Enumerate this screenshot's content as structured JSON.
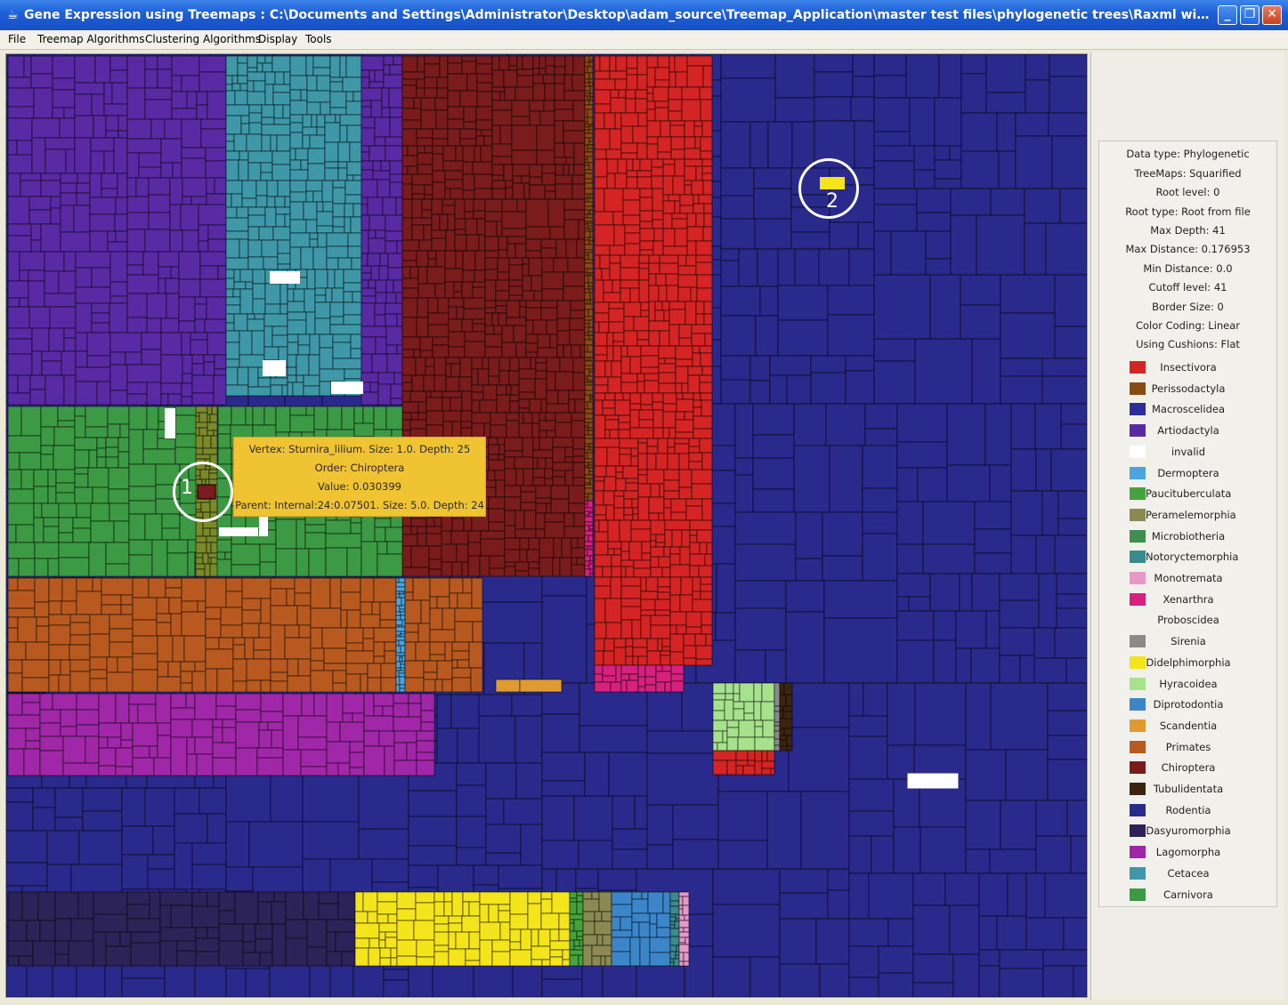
{
  "window": {
    "title": "Gene Expression using Treemaps : C:\\Documents and Settings\\Administrator\\Desktop\\adam_source\\Treemap_Application\\master test files\\phylogenetic trees\\Raxml with order file\\RAxML_re...",
    "minimize": "_",
    "maximize": "❐",
    "close": "✕"
  },
  "menu": [
    "File",
    "Treemap Algorithms",
    "Clustering Algorithms",
    "Display",
    "Tools"
  ],
  "info": [
    "Data type: Phylogenetic",
    "TreeMaps: Squarified",
    "Root level: 0",
    "Root type: Root from file",
    "Max Depth: 41",
    "Max Distance: 0.176953",
    "Min Distance: 0.0",
    "Cutoff level: 41",
    "Border Size: 0",
    "Color Coding: Linear",
    "Using Cushions: Flat"
  ],
  "legend": [
    {
      "label": "Insectivora",
      "color": "#d42424"
    },
    {
      "label": "Perissodactyla",
      "color": "#8a4b12"
    },
    {
      "label": "Macroscelidea",
      "color": "#2c2c9c"
    },
    {
      "label": "Artiodactyla",
      "color": "#5a2aa4"
    },
    {
      "label": "invalid",
      "color": "#ffffff"
    },
    {
      "label": "Dermoptera",
      "color": "#4aa4e0"
    },
    {
      "label": "Paucituberculata",
      "color": "#46a23c"
    },
    {
      "label": "Peramelemorphia",
      "color": "#8a8a52"
    },
    {
      "label": "Microbiotheria",
      "color": "#3e8e50"
    },
    {
      "label": "Notoryctemorphia",
      "color": "#3a8a8e"
    },
    {
      "label": "Monotremata",
      "color": "#e898c8"
    },
    {
      "label": "Xenarthra",
      "color": "#d8207e"
    },
    {
      "label": "Proboscidea",
      "color": "#f1f0ea"
    },
    {
      "label": "Sirenia",
      "color": "#8a8a8a"
    },
    {
      "label": "Didelphimorphia",
      "color": "#f4e41c"
    },
    {
      "label": "Hyracoidea",
      "color": "#a6e28c"
    },
    {
      "label": "Diprotodontia",
      "color": "#3a86c8"
    },
    {
      "label": "Scandentia",
      "color": "#e09a32"
    },
    {
      "label": "Primates",
      "color": "#b85a20"
    },
    {
      "label": "Chiroptera",
      "color": "#7a1c1c"
    },
    {
      "label": "Tubulidentata",
      "color": "#3c2410"
    },
    {
      "label": "Rodentia",
      "color": "#2a2a8c"
    },
    {
      "label": "Dasyuromorphia",
      "color": "#2c2458"
    },
    {
      "label": "Lagomorpha",
      "color": "#a028a8"
    },
    {
      "label": "Cetacea",
      "color": "#3e98a8"
    },
    {
      "label": "Carnivora",
      "color": "#3c9a44"
    }
  ],
  "tooltip": {
    "line1": "Vertex: Sturnira_lilium. Size: 1.0. Depth: 25",
    "line2": "Order: Chiroptera",
    "line3": "Value: 0.030399",
    "line4": "Parent: Internal:24:0.07501. Size: 5.0. Depth: 24"
  },
  "markers": [
    "1",
    "2"
  ]
}
